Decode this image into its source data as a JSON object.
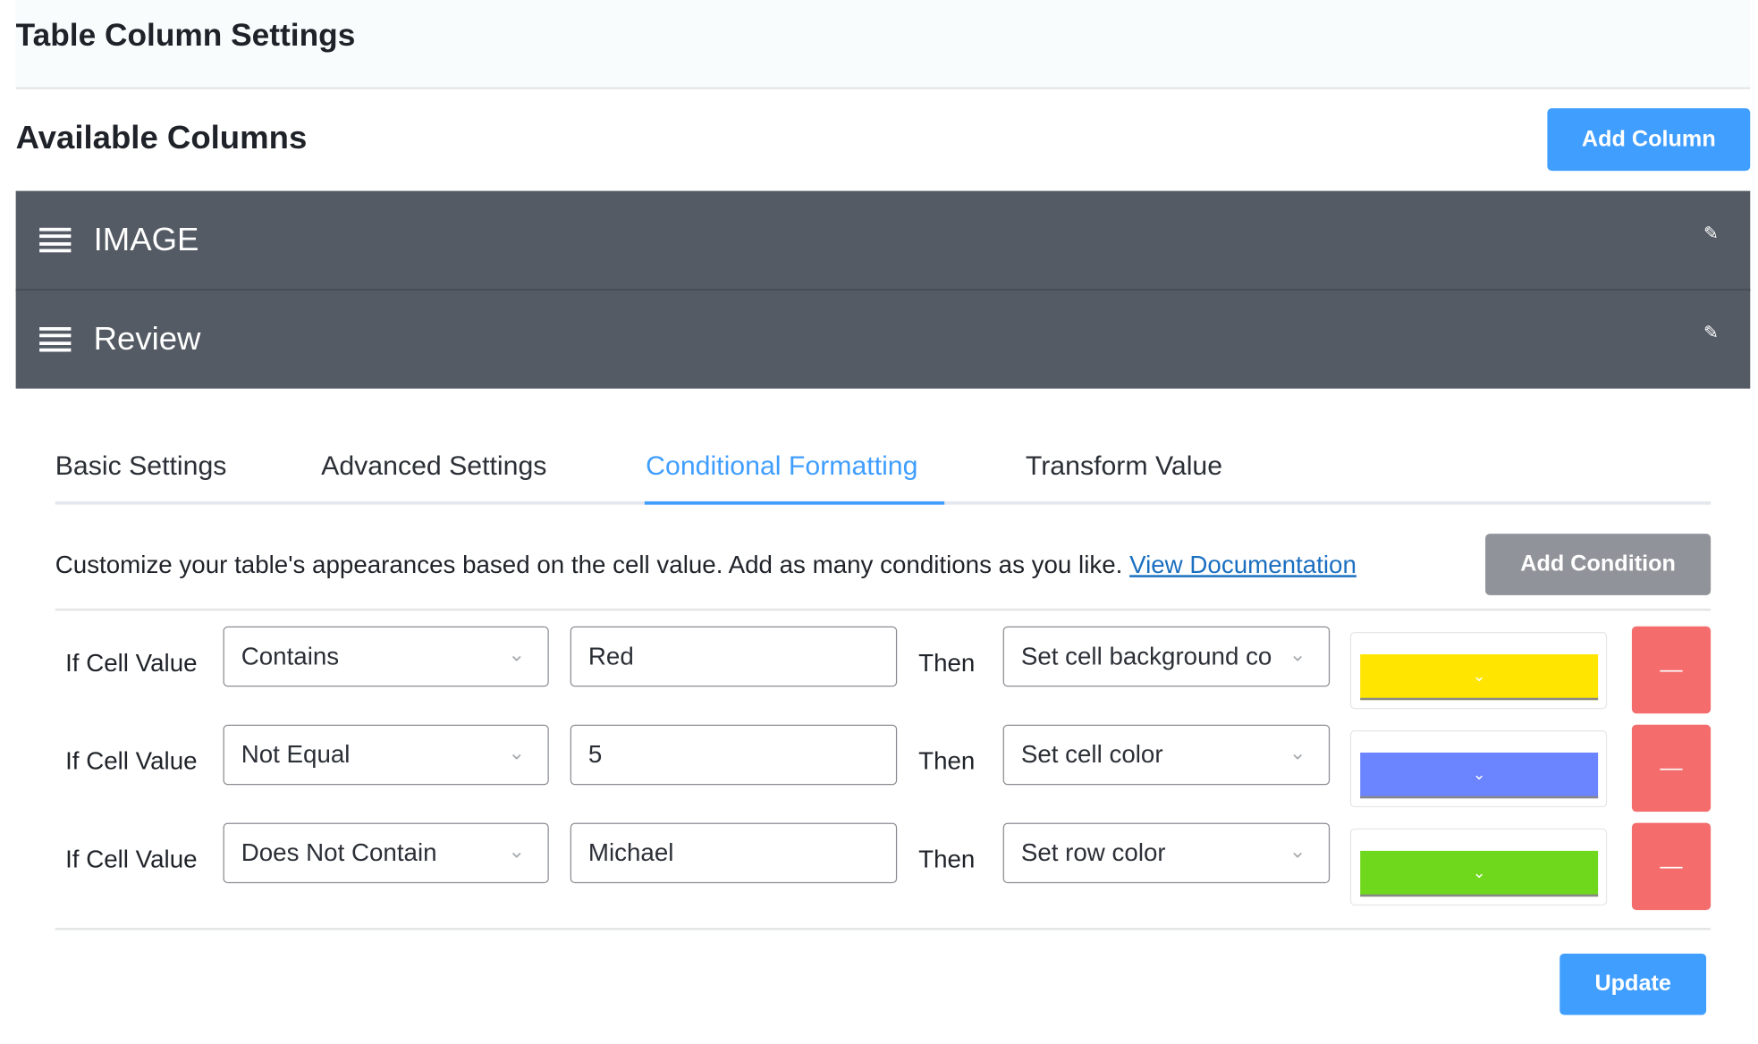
{
  "header": {
    "title": "Table Column Settings"
  },
  "columns": {
    "title": "Available Columns",
    "add_label": "Add Column",
    "items": [
      {
        "label": "IMAGE"
      },
      {
        "label": "Review"
      }
    ]
  },
  "tabs": [
    {
      "label": "Basic Settings"
    },
    {
      "label": "Advanced Settings"
    },
    {
      "label": "Conditional Formatting",
      "active": true
    },
    {
      "label": "Transform Value"
    }
  ],
  "conditional": {
    "description": "Customize your table's appearances based on the cell value. Add as many conditions as you like.",
    "doc_link": "View Documentation",
    "add_label": "Add Condition",
    "if_label": "If Cell Value",
    "then_label": "Then",
    "rows": [
      {
        "operator": "Contains",
        "value": "Red",
        "action": "Set cell background color",
        "color": "#ffe500"
      },
      {
        "operator": "Not Equal",
        "value": "5",
        "action": "Set cell color",
        "color": "#6b84ff"
      },
      {
        "operator": "Does Not Contain",
        "value": "Michael",
        "action": "Set row color",
        "color": "#6fd81c"
      }
    ]
  },
  "update_label": "Update",
  "colors": {
    "primary": "#409eff",
    "danger": "#f56c6c",
    "secondary": "#909399",
    "column_row": "#545b64"
  }
}
